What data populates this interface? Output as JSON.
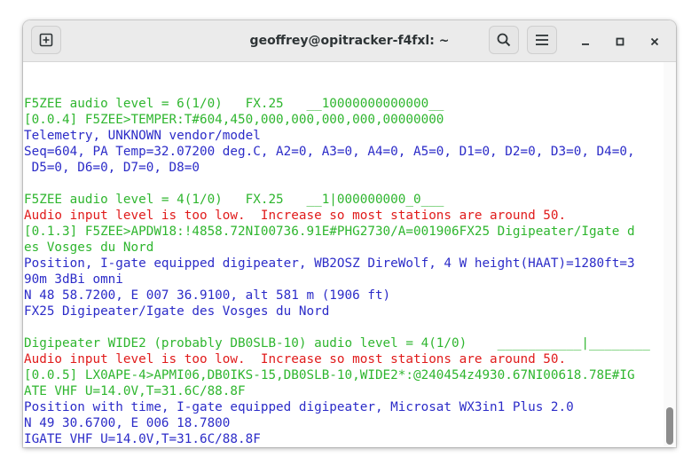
{
  "window": {
    "title": "geoffrey@opitracker-f4fxl: ~"
  },
  "icons": {
    "new_tab": "new-tab-icon",
    "search": "search-icon",
    "menu": "hamburger-menu-icon",
    "minimize": "minimize-icon",
    "maximize": "maximize-icon",
    "close": "close-icon"
  },
  "colors": {
    "green": "#2fb62f",
    "blue": "#2c2cc8",
    "red": "#e01b1b"
  },
  "terminal": {
    "lines": [
      {
        "text": "",
        "color": "green"
      },
      {
        "text": "F5ZEE audio level = 6(1/0)   FX.25   __10000000000000__",
        "color": "green"
      },
      {
        "text": "[0.0.4] F5ZEE>TEMPER:T#604,450,000,000,000,000,00000000",
        "color": "green"
      },
      {
        "text": "Telemetry, UNKNOWN vendor/model",
        "color": "blue"
      },
      {
        "text": "Seq=604, PA Temp=32.07200 deg.C, A2=0, A3=0, A4=0, A5=0, D1=0, D2=0, D3=0, D4=0,",
        "color": "blue"
      },
      {
        "text": " D5=0, D6=0, D7=0, D8=0",
        "color": "blue"
      },
      {
        "text": "",
        "color": "green"
      },
      {
        "text": "F5ZEE audio level = 4(1/0)   FX.25   __1|000000000_0___",
        "color": "green"
      },
      {
        "text": "Audio input level is too low.  Increase so most stations are around 50.",
        "color": "red"
      },
      {
        "text": "[0.1.3] F5ZEE>APDW18:!4858.72NI00736.91E#PHG2730/A=001906FX25 Digipeater/Igate d",
        "color": "green"
      },
      {
        "text": "es Vosges du Nord",
        "color": "green"
      },
      {
        "text": "Position, I-gate equipped digipeater, WB2OSZ DireWolf, 4 W height(HAAT)=1280ft=3",
        "color": "blue"
      },
      {
        "text": "90m 3dBi omni",
        "color": "blue"
      },
      {
        "text": "N 48 58.7200, E 007 36.9100, alt 581 m (1906 ft)",
        "color": "blue"
      },
      {
        "text": "FX25 Digipeater/Igate des Vosges du Nord",
        "color": "blue"
      },
      {
        "text": "",
        "color": "green"
      },
      {
        "text": "Digipeater WIDE2 (probably DB0SLB-10) audio level = 4(1/0)    ___________|________",
        "color": "green"
      },
      {
        "text": "Audio input level is too low.  Increase so most stations are around 50.",
        "color": "red"
      },
      {
        "text": "[0.0.5] LX0APE-4>APMI06,DB0IKS-15,DB0SLB-10,WIDE2*:@240454z4930.67NI00618.78E#IG",
        "color": "green"
      },
      {
        "text": "ATE VHF U=14.0V,T=31.6C/88.8F",
        "color": "green"
      },
      {
        "text": "Position with time, I-gate equipped digipeater, Microsat WX3in1 Plus 2.0",
        "color": "blue"
      },
      {
        "text": "N 49 30.6700, E 006 18.7800",
        "color": "blue"
      },
      {
        "text": "IGATE VHF U=14.0V,T=31.6C/88.8F",
        "color": "blue"
      }
    ]
  }
}
